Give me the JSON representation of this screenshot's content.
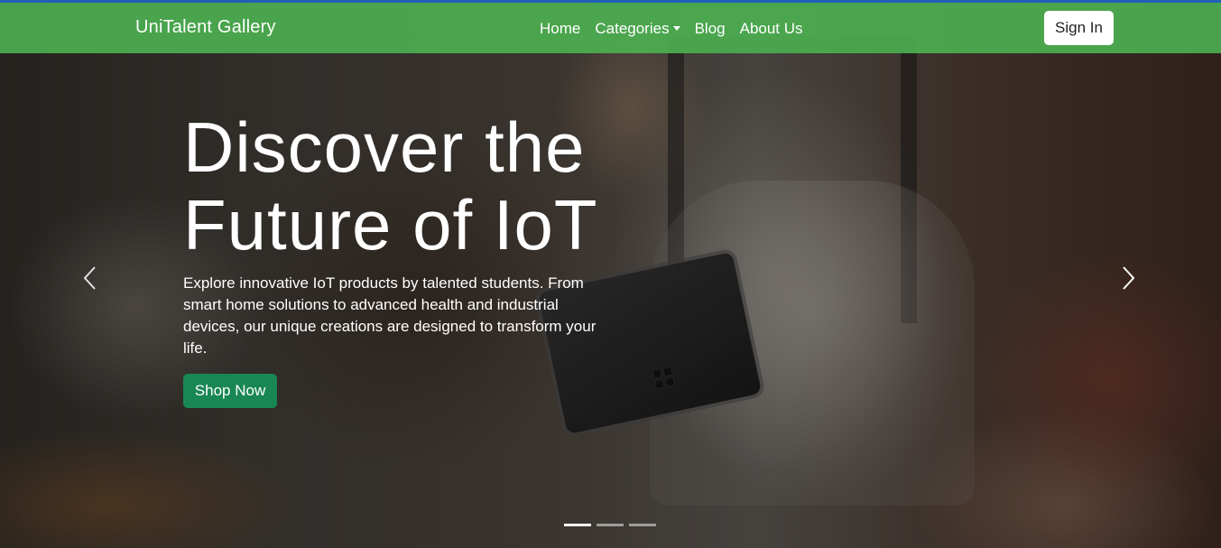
{
  "navbar": {
    "brand": "UniTalent Gallery",
    "links": [
      "Home",
      "Categories",
      "Blog",
      "About Us"
    ],
    "signin_label": "Sign In",
    "background_color": "#4caf50"
  },
  "hero": {
    "headline": "Discover the Future of IoT",
    "description": "Explore innovative IoT products by talented students. From smart home solutions to advanced health and industrial devices, our unique creations are designed to transform your life.",
    "cta_label": "Shop Now",
    "cta_color": "#198754"
  },
  "carousel": {
    "prev_icon": "chevron-left-icon",
    "next_icon": "chevron-right-icon",
    "slide_count": 3,
    "active_slide": 1
  }
}
